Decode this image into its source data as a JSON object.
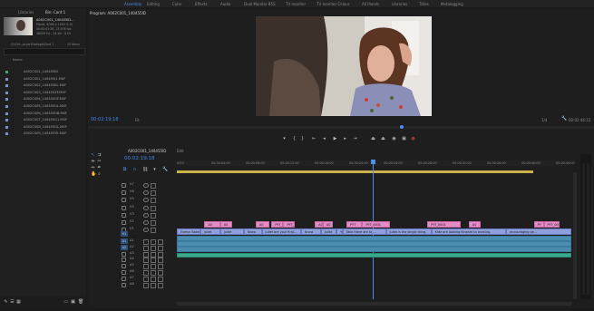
{
  "workspaces": [
    {
      "label": "Assembly",
      "active": true
    },
    {
      "label": "Editing",
      "active": false
    },
    {
      "label": "Color",
      "active": false
    },
    {
      "label": "Effects",
      "active": false
    },
    {
      "label": "Audio",
      "active": false
    },
    {
      "label": "Dual Monitor 85S",
      "active": false
    },
    {
      "label": "TV monitor",
      "active": false
    },
    {
      "label": "TV monitor Colour",
      "active": false
    },
    {
      "label": "All Panels",
      "active": false
    },
    {
      "label": "Libraries",
      "active": false
    },
    {
      "label": "Titles",
      "active": false
    },
    {
      "label": "Metalogging",
      "active": false
    }
  ],
  "project_panel": {
    "tabs": [
      "Libraries",
      "Bin: Card 1"
    ],
    "clip_name": "A002C001_140455ID...",
    "clip_meta": [
      "Movie, 4096 x 2160 (1.0)",
      "00:00:05:26, 23.976 fps",
      "48000 Hz - 24-bit - 8 Ch"
    ],
    "path": "Q:\\Crit...pryer\\Footage\\Card 1",
    "item_count": "10 Items",
    "name_header": "Name",
    "files": [
      "A002C001_140455ID",
      "A002C001_140455I1.MXF",
      "A002C002_140455KL.MXF",
      "A002C003_140455ZF.MXF",
      "A002C004_140455OF.MXF",
      "A002C005_140455UL.MXF",
      "A002C006_140455UB.MXF",
      "A002C007_140455G1.MXF",
      "A002C008_140455GL.MXF",
      "A002C009_140455YE.MXF"
    ]
  },
  "program_monitor": {
    "title": "Program: A002C001_140455ID",
    "timecode": "00:02:19:18",
    "fit": "Fit",
    "resolution": "1/4",
    "duration": "00:02:46:15"
  },
  "timeline": {
    "sequence_tab": "A002C001_140455ID",
    "other_tab": "Edit",
    "timecode": "00:02:19:18",
    "ruler_ticks": [
      "0:00",
      "00:00:04:00",
      "00:00:08:00",
      "00:00:12:00",
      "00:00:16:00",
      "00:00:20:00",
      "00:00:24:00",
      "00:00:28:00",
      "00:00:32:00",
      "00:00:36:00",
      "00:00:40:00",
      "00:00:44:00"
    ],
    "video_tracks": [
      "V7",
      "V6",
      "V5",
      "V4",
      "V3",
      "V2",
      "V1"
    ],
    "audio_tracks": [
      "A1",
      "A2",
      "A3",
      "A4",
      "A5",
      "A6",
      "A7",
      "A8"
    ],
    "v2_clips": [
      {
        "label": "A0",
        "start": 0.07,
        "end": 0.11
      },
      {
        "label": "A0",
        "start": 0.11,
        "end": 0.14
      },
      {
        "label": "A0",
        "start": 0.2,
        "end": 0.235
      },
      {
        "label": "PYT_",
        "start": 0.24,
        "end": 0.27
      },
      {
        "label": "PYT_0001",
        "start": 0.27,
        "end": 0.3
      },
      {
        "label": "A0",
        "start": 0.35,
        "end": 0.37
      },
      {
        "label": "A0",
        "start": 0.37,
        "end": 0.395
      },
      {
        "label": "PYT",
        "start": 0.43,
        "end": 0.47
      },
      {
        "label": "PYT_0001",
        "start": 0.47,
        "end": 0.54
      },
      {
        "label": "PYT_0001",
        "start": 0.635,
        "end": 0.72
      },
      {
        "label": "A0",
        "start": 0.74,
        "end": 0.77
      },
      {
        "label": "PY",
        "start": 0.905,
        "end": 0.93
      },
      {
        "label": "PYT_000",
        "start": 0.93,
        "end": 0.97
      }
    ],
    "v1_clips": [
      {
        "label": "Evelyn Baker",
        "start": 0.0,
        "end": 0.06
      },
      {
        "label": "Juliet",
        "start": 0.06,
        "end": 0.11
      },
      {
        "label": "Juliet",
        "start": 0.11,
        "end": 0.17
      },
      {
        "label": "Know",
        "start": 0.17,
        "end": 0.215
      },
      {
        "label": "Juliet are your first...",
        "start": 0.215,
        "end": 0.315
      },
      {
        "label": "Know",
        "start": 0.315,
        "end": 0.365
      },
      {
        "label": "Juliet",
        "start": 0.365,
        "end": 0.405
      },
      {
        "label": "Yeah.",
        "start": 0.405,
        "end": 0.42
      },
      {
        "label": "Take there are to ...",
        "start": 0.42,
        "end": 0.53
      },
      {
        "label": "Juliet is the single thing.",
        "start": 0.53,
        "end": 0.645
      },
      {
        "label": "Kate are looking forward to working.",
        "start": 0.645,
        "end": 0.835
      },
      {
        "label": "encouraging pe...",
        "start": 0.835,
        "end": 1.0
      }
    ]
  }
}
